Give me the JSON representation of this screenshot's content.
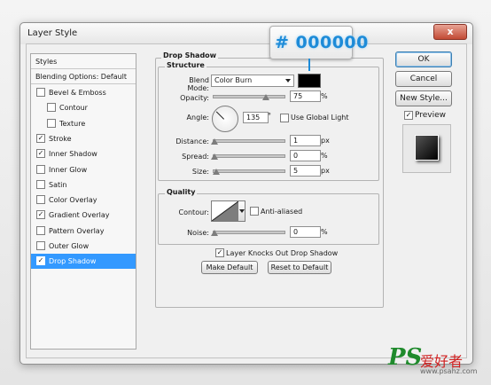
{
  "window": {
    "title": "Layer Style",
    "close_glyph": "x"
  },
  "styles_panel": {
    "header": "Styles",
    "blending_options": "Blending Options: Default",
    "items": [
      {
        "label": "Bevel & Emboss",
        "checked": false,
        "indent": 0
      },
      {
        "label": "Contour",
        "checked": false,
        "indent": 1
      },
      {
        "label": "Texture",
        "checked": false,
        "indent": 1
      },
      {
        "label": "Stroke",
        "checked": true,
        "indent": 0
      },
      {
        "label": "Inner Shadow",
        "checked": true,
        "indent": 0
      },
      {
        "label": "Inner Glow",
        "checked": false,
        "indent": 0
      },
      {
        "label": "Satin",
        "checked": false,
        "indent": 0
      },
      {
        "label": "Color Overlay",
        "checked": false,
        "indent": 0
      },
      {
        "label": "Gradient Overlay",
        "checked": true,
        "indent": 0
      },
      {
        "label": "Pattern Overlay",
        "checked": false,
        "indent": 0
      },
      {
        "label": "Outer Glow",
        "checked": false,
        "indent": 0
      },
      {
        "label": "Drop Shadow",
        "checked": true,
        "indent": 0,
        "selected": true
      }
    ]
  },
  "drop_shadow": {
    "title": "Drop Shadow",
    "structure": {
      "title": "Structure",
      "blend_mode_label": "Blend Mode:",
      "blend_mode_value": "Color Burn",
      "shadow_color": "#000000",
      "opacity_label": "Opacity:",
      "opacity_value": "75",
      "opacity_level": 0.75,
      "angle_label": "Angle:",
      "angle_value": "135",
      "global_light_label": "Use Global Light",
      "global_light_checked": false,
      "distance_label": "Distance:",
      "distance_value": "1",
      "spread_label": "Spread:",
      "spread_value": "0",
      "size_label": "Size:",
      "size_value": "5",
      "percent": "%",
      "px": "px"
    },
    "quality": {
      "title": "Quality",
      "contour_label": "Contour:",
      "anti_aliased_label": "Anti-aliased",
      "anti_aliased_checked": false,
      "noise_label": "Noise:",
      "noise_value": "0",
      "percent": "%"
    },
    "knocks_out_label": "Layer Knocks Out Drop Shadow",
    "knocks_out_checked": true,
    "make_default": "Make Default",
    "reset_default": "Reset to Default"
  },
  "buttons": {
    "ok": "OK",
    "cancel": "Cancel",
    "new_style": "New Style...",
    "preview_label": "Preview",
    "preview_checked": true
  },
  "callout": {
    "text": "# 000000",
    "color": "#1d8bd8"
  },
  "watermark": {
    "logo": "PS",
    "chinese": "爱好者",
    "url": "www.psahz.com"
  },
  "check_glyph": "✓"
}
